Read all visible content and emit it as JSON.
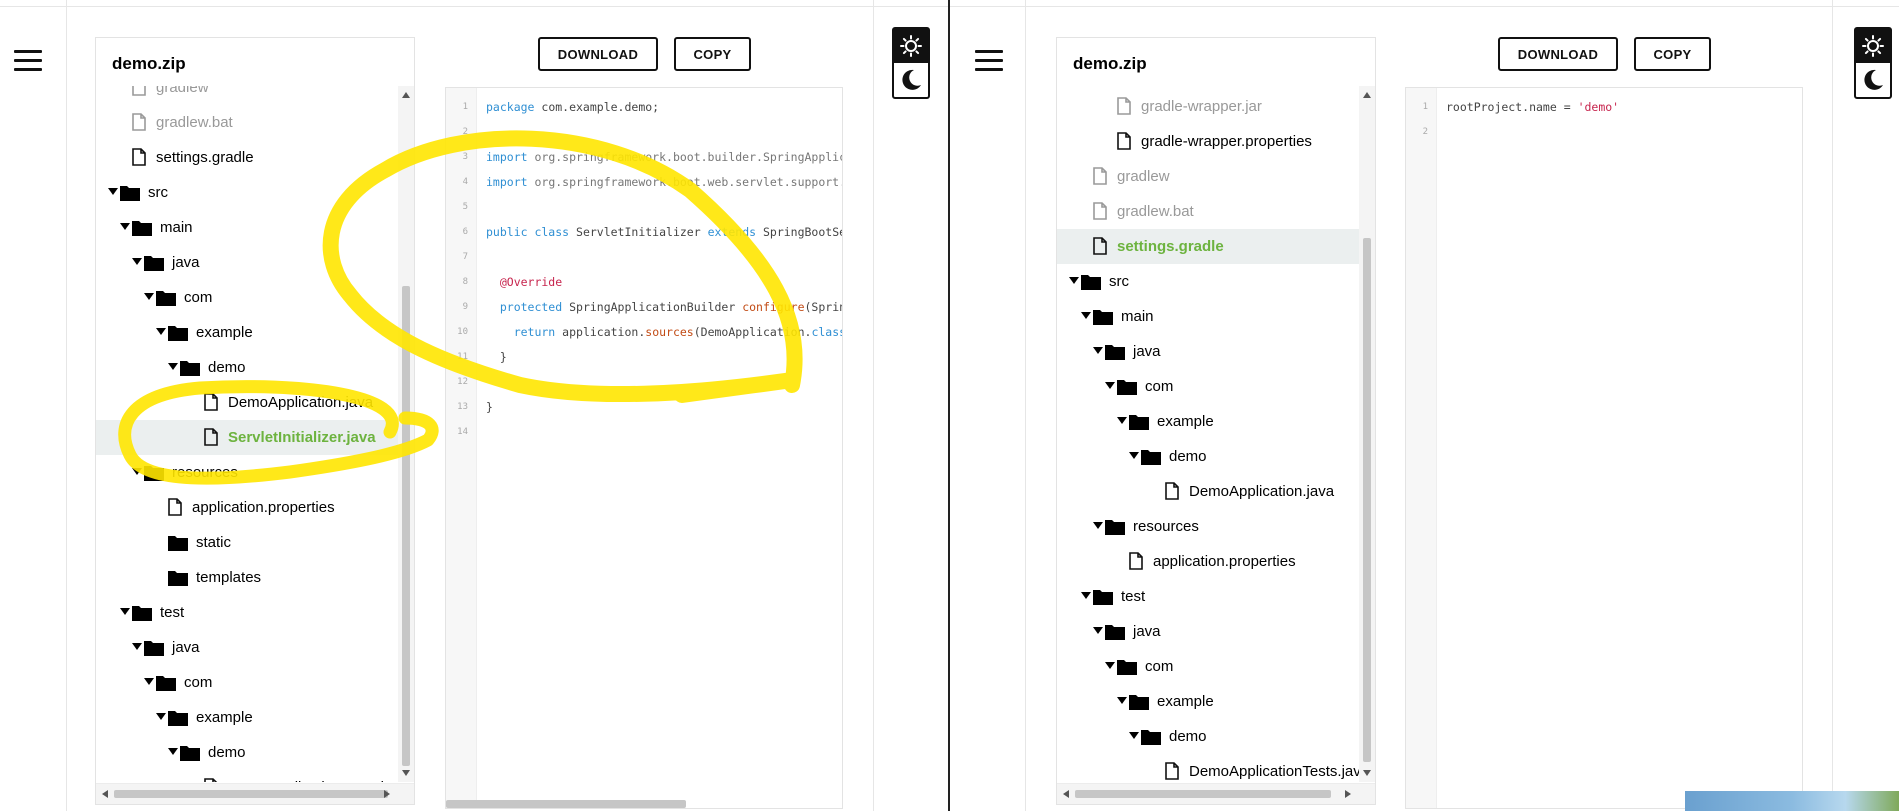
{
  "left": {
    "explorer": {
      "title": "demo.zip",
      "items": [
        {
          "label": "gradlew",
          "type": "file",
          "depth": 1,
          "muted": true
        },
        {
          "label": "gradlew.bat",
          "type": "file",
          "depth": 1,
          "muted": true
        },
        {
          "label": "settings.gradle",
          "type": "file",
          "depth": 1
        },
        {
          "label": "src",
          "type": "folder",
          "depth": 0
        },
        {
          "label": "main",
          "type": "folder",
          "depth": 1
        },
        {
          "label": "java",
          "type": "folder",
          "depth": 2
        },
        {
          "label": "com",
          "type": "folder",
          "depth": 3
        },
        {
          "label": "example",
          "type": "folder",
          "depth": 4
        },
        {
          "label": "demo",
          "type": "folder",
          "depth": 5
        },
        {
          "label": "DemoApplication.java",
          "type": "file",
          "depth": 7
        },
        {
          "label": "ServletInitializer.java",
          "type": "file",
          "depth": 7,
          "selected": true
        },
        {
          "label": "resources",
          "type": "folder",
          "depth": 2
        },
        {
          "label": "application.properties",
          "type": "file",
          "depth": 4
        },
        {
          "label": "static",
          "type": "folder",
          "depth": 4,
          "nocaret": true
        },
        {
          "label": "templates",
          "type": "folder",
          "depth": 4,
          "nocaret": true
        },
        {
          "label": "test",
          "type": "folder",
          "depth": 1
        },
        {
          "label": "java",
          "type": "folder",
          "depth": 2
        },
        {
          "label": "com",
          "type": "folder",
          "depth": 3
        },
        {
          "label": "example",
          "type": "folder",
          "depth": 4
        },
        {
          "label": "demo",
          "type": "folder",
          "depth": 5
        },
        {
          "label": "DemoApplicationTests.java",
          "type": "file",
          "depth": 7
        }
      ]
    },
    "buttons": {
      "download": "DOWNLOAD",
      "copy": "COPY"
    },
    "code": [
      {
        "n": "1",
        "tokens": [
          {
            "t": "package ",
            "c": "kw"
          },
          {
            "t": "com.example.demo;",
            "c": "cls"
          }
        ]
      },
      {
        "n": "2",
        "tokens": []
      },
      {
        "n": "3",
        "tokens": [
          {
            "t": "import ",
            "c": "kw"
          },
          {
            "t": "org.springframework.boot.builder.SpringApplicationBuilder;",
            "c": "pkg"
          }
        ]
      },
      {
        "n": "4",
        "tokens": [
          {
            "t": "import ",
            "c": "kw"
          },
          {
            "t": "org.springframework.boot.web.servlet.support.SpringBootServletInitializer;",
            "c": "pkg"
          }
        ]
      },
      {
        "n": "5",
        "tokens": []
      },
      {
        "n": "6",
        "tokens": [
          {
            "t": "public class ",
            "c": "kw"
          },
          {
            "t": "ServletInitializer ",
            "c": "cls"
          },
          {
            "t": "extends ",
            "c": "kw"
          },
          {
            "t": "SpringBootServletInitializer {",
            "c": "cls"
          }
        ]
      },
      {
        "n": "7",
        "tokens": []
      },
      {
        "n": "8",
        "tokens": [
          {
            "t": "  @Override",
            "c": "ann"
          }
        ]
      },
      {
        "n": "9",
        "tokens": [
          {
            "t": "  protected ",
            "c": "kw"
          },
          {
            "t": "SpringApplicationBuilder ",
            "c": "cls"
          },
          {
            "t": "configure",
            "c": "fn"
          },
          {
            "t": "(SpringApplicationBuilder application) {",
            "c": "cls"
          }
        ]
      },
      {
        "n": "10",
        "tokens": [
          {
            "t": "    return ",
            "c": "kw"
          },
          {
            "t": "application.",
            "c": "cls"
          },
          {
            "t": "sources",
            "c": "fn"
          },
          {
            "t": "(DemoApplication.",
            "c": "cls"
          },
          {
            "t": "class",
            "c": "kw"
          },
          {
            "t": ");",
            "c": "cls"
          }
        ]
      },
      {
        "n": "11",
        "tokens": [
          {
            "t": "  }",
            "c": "cls"
          }
        ]
      },
      {
        "n": "12",
        "tokens": []
      },
      {
        "n": "13",
        "tokens": [
          {
            "t": "}",
            "c": "cls"
          }
        ]
      },
      {
        "n": "14",
        "tokens": []
      }
    ],
    "theme": {
      "light_icon": "sun-icon",
      "dark_icon": "moon-icon"
    }
  },
  "right": {
    "explorer": {
      "title": "demo.zip",
      "items": [
        {
          "label": "gradle-wrapper.jar",
          "type": "file",
          "depth": 3,
          "muted": true
        },
        {
          "label": "gradle-wrapper.properties",
          "type": "file",
          "depth": 3
        },
        {
          "label": "gradlew",
          "type": "file",
          "depth": 1,
          "muted": true
        },
        {
          "label": "gradlew.bat",
          "type": "file",
          "depth": 1,
          "muted": true
        },
        {
          "label": "settings.gradle",
          "type": "file",
          "depth": 1,
          "selected": true
        },
        {
          "label": "src",
          "type": "folder",
          "depth": 0
        },
        {
          "label": "main",
          "type": "folder",
          "depth": 1
        },
        {
          "label": "java",
          "type": "folder",
          "depth": 2
        },
        {
          "label": "com",
          "type": "folder",
          "depth": 3
        },
        {
          "label": "example",
          "type": "folder",
          "depth": 4
        },
        {
          "label": "demo",
          "type": "folder",
          "depth": 5
        },
        {
          "label": "DemoApplication.java",
          "type": "file",
          "depth": 7
        },
        {
          "label": "resources",
          "type": "folder",
          "depth": 2
        },
        {
          "label": "application.properties",
          "type": "file",
          "depth": 4
        },
        {
          "label": "test",
          "type": "folder",
          "depth": 1
        },
        {
          "label": "java",
          "type": "folder",
          "depth": 2
        },
        {
          "label": "com",
          "type": "folder",
          "depth": 3
        },
        {
          "label": "example",
          "type": "folder",
          "depth": 4
        },
        {
          "label": "demo",
          "type": "folder",
          "depth": 5
        },
        {
          "label": "DemoApplicationTests.java",
          "type": "file",
          "depth": 7
        }
      ]
    },
    "buttons": {
      "download": "DOWNLOAD",
      "copy": "COPY"
    },
    "code": [
      {
        "n": "1",
        "tokens": [
          {
            "t": "rootProject.name = ",
            "c": "cls"
          },
          {
            "t": "'demo'",
            "c": "str"
          }
        ]
      },
      {
        "n": "2",
        "tokens": []
      }
    ],
    "theme": {
      "light_icon": "sun-icon",
      "dark_icon": "moon-icon"
    }
  },
  "colors": {
    "accent": "#6db33f",
    "annotation": "#ffe600",
    "selected_row": "#ebefef"
  }
}
